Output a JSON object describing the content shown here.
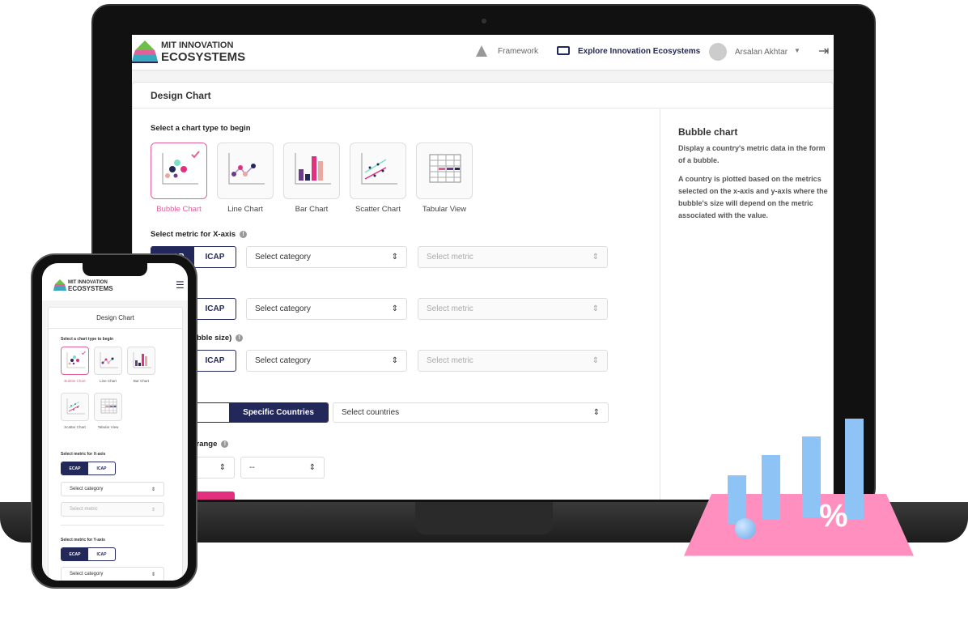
{
  "brand": {
    "line1": "MIT INNOVATION",
    "line2": "ECOSYSTEMS"
  },
  "nav": {
    "framework": "Framework",
    "explore": "Explore Innovation Ecosystems",
    "user": "Arsalan Akhtar"
  },
  "card_title": "Design Chart",
  "chart_type_prompt": "Select a chart type to begin",
  "chart_types": [
    {
      "label": "Bubble Chart",
      "selected": true
    },
    {
      "label": "Line Chart"
    },
    {
      "label": "Bar Chart"
    },
    {
      "label": "Scatter Chart"
    },
    {
      "label": "Tabular View"
    }
  ],
  "rows": [
    {
      "label": "Select metric for X-axis",
      "toggle": [
        "ECAP",
        "ICAP"
      ],
      "category": "Select category",
      "metric": "Select metric"
    },
    {
      "label": "for Y-axis",
      "toggle": [
        "ECAP",
        "ICAP"
      ],
      "category": "Select category",
      "metric": "Select metric"
    },
    {
      "label": "for value (bubble size)",
      "toggle": [
        "ECAP",
        "ICAP"
      ],
      "category": "Select category",
      "metric": "Select metric"
    }
  ],
  "countries": {
    "label": "ies",
    "options": [
      "ries",
      "Specific Countries"
    ],
    "select": "Select countries"
  },
  "year": {
    "label": "year or year range",
    "to": "--"
  },
  "info_panel": {
    "title": "Bubble chart",
    "p1": "Display a country's metric data in the form of a bubble.",
    "p2": "A country is plotted based on the metrics selected on the x-axis and y-axis where the bubble's size will depend on the metric associated with the value."
  },
  "phone": {
    "x_label": "Select metric for X-axis",
    "y_label": "Select metric for Y-axis",
    "category": "Select category",
    "metric": "Select metric"
  },
  "colors": {
    "navy": "#23285a",
    "pink": "#e2609a"
  }
}
